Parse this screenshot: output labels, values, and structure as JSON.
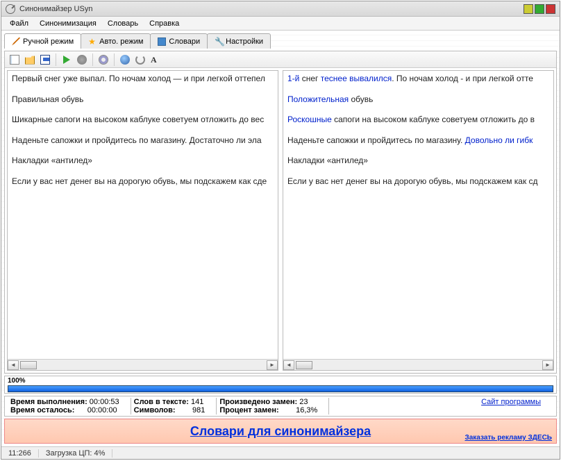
{
  "title": "Синонимайзер USyn",
  "menus": [
    "Файл",
    "Синонимизация",
    "Словарь",
    "Справка"
  ],
  "tabs": [
    {
      "label": "Ручной режим",
      "active": true
    },
    {
      "label": "Авто. режим",
      "active": false
    },
    {
      "label": "Словари",
      "active": false
    },
    {
      "label": "Настройки",
      "active": false
    }
  ],
  "left_pane": [
    {
      "t": "Первый снег уже выпал. По ночам холод — и при легкой оттепел"
    },
    {
      "t": "Правильная обувь"
    },
    {
      "t": "Шикарные сапоги на высоком каблуке советуем отложить до вес"
    },
    {
      "t": "Наденьте сапожки и пройдитесь по магазину. Достаточно ли эла"
    },
    {
      "t": "Накладки «антилед»"
    },
    {
      "t": "Если у вас нет денег вы на дорогую обувь, мы подскажем как сде"
    }
  ],
  "right_pane": [
    [
      {
        "s": "1-й",
        "h": 1
      },
      {
        "s": " снег "
      },
      {
        "s": "теснее вывалился",
        "h": 1
      },
      {
        "s": ". По ночам холод - и при легкой отте"
      }
    ],
    [
      {
        "s": "Положительная",
        "h": 1
      },
      {
        "s": " обувь"
      }
    ],
    [
      {
        "s": "Роскошные",
        "h": 1
      },
      {
        "s": " сапоги на высоком каблуке советуем отложить до в"
      }
    ],
    [
      {
        "s": "Наденьте сапожки и пройдитесь по магазину. "
      },
      {
        "s": "Довольно ли гибк",
        "h": 1
      }
    ],
    [
      {
        "s": "Накладки «антилед»"
      }
    ],
    [
      {
        "s": "Если у вас нет денег вы на дорогую обувь, мы подскажем как сд"
      }
    ]
  ],
  "progress": {
    "percent": "100%"
  },
  "stats": {
    "time_exec_lbl": "Время выполнения:",
    "time_exec": "00:00:53",
    "time_left_lbl": "Время осталось:",
    "time_left": "00:00:00",
    "words_lbl": "Слов в тексте:",
    "words": "141",
    "chars_lbl": "Символов:",
    "chars": "981",
    "repl_lbl": "Произведено замен:",
    "repl": "23",
    "repl_pct_lbl": "Процент замен:",
    "repl_pct": "16,3%",
    "site_link": "Сайт программы"
  },
  "ad": {
    "main": "Словари для синонимайзера",
    "order": "Заказать рекламу ЗДЕСЬ"
  },
  "status": {
    "pos": "11:266",
    "cpu": "Загрузка ЦП: 4%"
  }
}
